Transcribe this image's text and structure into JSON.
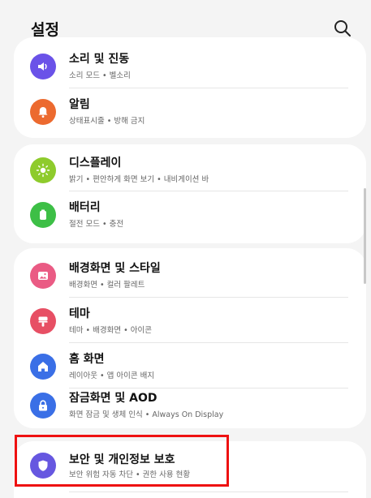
{
  "header": {
    "title": "설정",
    "search_icon": "search-icon"
  },
  "colors": {
    "sound": "#6a52e8",
    "notifications": "#ec6a2f",
    "display": "#8ecb2c",
    "battery": "#3dbf46",
    "wallpaper": "#ea5b84",
    "themes": "#e74f64",
    "home_screen": "#3a6fe6",
    "lock_screen": "#3a6fe6",
    "security": "#6657e0",
    "highlight": "#ee1111"
  },
  "items": [
    {
      "label": "소리 및 진동",
      "sub": "소리 모드 • 벨소리",
      "icon": "speaker-icon"
    },
    {
      "label": "알림",
      "sub": "상태표시줄 • 방해 금지",
      "icon": "bell-icon"
    },
    {
      "label": "디스플레이",
      "sub": "밝기 • 편안하게 화면 보기 • 내비게이션 바",
      "icon": "sun-icon"
    },
    {
      "label": "배터리",
      "sub": "절전 모드 • 충전",
      "icon": "battery-icon"
    },
    {
      "label": "배경화면 및 스타일",
      "sub": "배경화면 • 컬러 팔레트",
      "icon": "picture-icon"
    },
    {
      "label": "테마",
      "sub": "테마 • 배경화면 • 아이콘",
      "icon": "paintbrush-icon"
    },
    {
      "label": "홈 화면",
      "sub": "레이아웃 • 앱 아이콘 배지",
      "icon": "home-icon"
    },
    {
      "label": "잠금화면 및 AOD",
      "sub": "화면 잠금 및 생체 인식 • Always On Display",
      "icon": "lock-icon"
    },
    {
      "label": "보안 및 개인정보 보호",
      "sub": "보안 위험 자동 차단 • 권한 사용 현황",
      "icon": "shield-icon"
    }
  ]
}
